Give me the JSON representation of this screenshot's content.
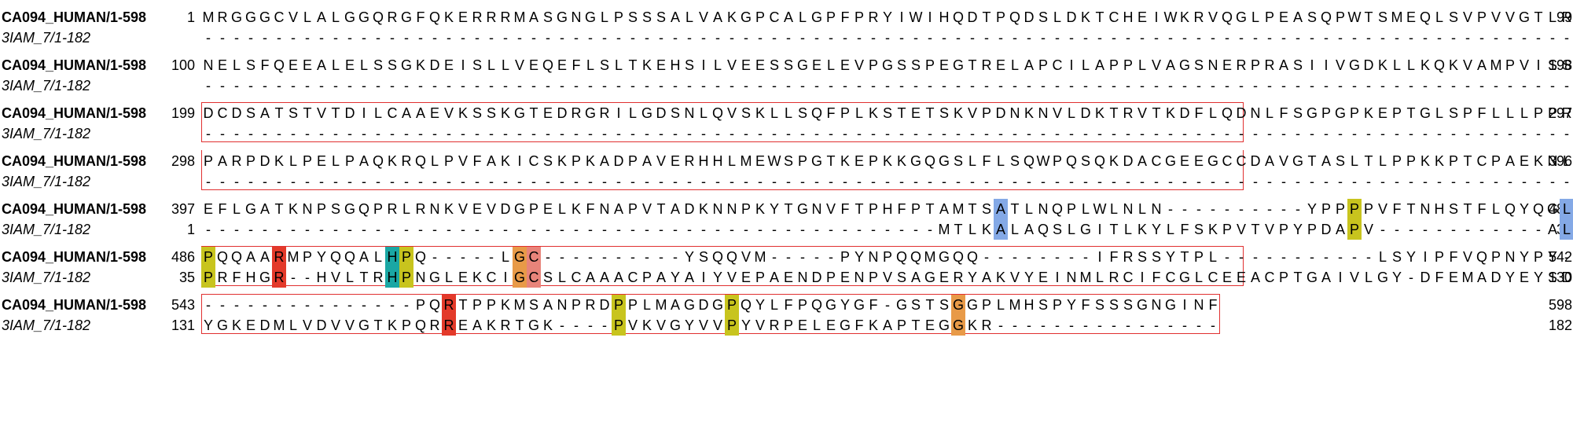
{
  "alignment": {
    "seq1_name": "CA094_HUMAN/1-598",
    "seq2_name": "3IAM_7/1-182",
    "blocks": [
      {
        "l1": "1",
        "s1": "MRGGGCVLALGGQRGFQKERRRMASGNGLPSSSALVAKGPCALGPFPRYIWIHQDTPQDSLDKTCHEIWKRVQGLPEASQPWTSMEQLSVPVVGTLRG",
        "r1": "99",
        "l2": "",
        "s2": "-------------------------------------------------------------------------------------------------",
        "r2": "",
        "box": "none"
      },
      {
        "l1": "100",
        "s1": "NELSFQEEALELSSGKDEISLLVEQEFLSLTKEHSILVEESSGELEVPGSSPEGTRELAPCILAPPLVAGSNERPRASIIVGDKLLKQKVAMPVISSRQ",
        "r1": "198",
        "l2": "",
        "s2": "---------------------------------------------------------------------------------------------------",
        "r2": "",
        "box": "none"
      },
      {
        "l1": "199",
        "s1": "DCDSATSTVTDILCAAEVKSSKGTEDRGRILGDSNLQVSKLLSQFPLKSTETSKVPDNKNVLDKTRVTKDFLQDNLFSGPGPKEPTGLSPFLLLPPRPP",
        "r1": "297",
        "l2": "",
        "s2": "---------------------------------------------------------------------------------------------------",
        "r2": "",
        "box": "full"
      },
      {
        "l1": "298",
        "s1": "PARPDKLPELPAQKRQLPVFAKICSKPKADPAVERHHLMEWSPGTKEPKKGQGSLFLSQWPQSQKDACGEEGCCDAVGTASLTLPPKKPTCPAEKNLLY",
        "r1": "396",
        "l2": "",
        "s2": "---------------------------------------------------------------------------------------------------",
        "r2": "",
        "box": "open-top"
      },
      {
        "l1": "397",
        "s1": "EFLGATKNPSGQPRLRNKVEVDGPELKFNAPVTADKNNPKYTGNVFTPHFPTAMTSATLNQPLWLNLN----------YPPPPVFTNHSTFLQYQGLY",
        "r1": "485",
        "l2": "1",
        "s2": "----------------------------------------------------MTLKALAQSLGITLKYLFSKPVTVPYPDAPV------------ALK",
        "r2": "34",
        "box": "none"
      },
      {
        "l1": "486",
        "s1": "PQQAARMPYQQALHPQ-----LGC----------YSQQVM-----PYNPQQMGQQ--------IFRSSYTPL-----------LSYIPFVQPNYPY----",
        "r1": "542",
        "l2": "35",
        "s2": "PRFHGR--HVLTRHPNGLEKCIGCSLCAAACPAYAIYVEPAENDPENPVSAGERYAKVYEINMLRCIFCGLCEEACPTGAIVLGY-DFEMADYEYSDLV",
        "r2": "130",
        "box": "full"
      },
      {
        "l1": "543",
        "s1": "---------------PQRTPPKMSANPRDPPLMAGDGPQYLFPQGYGF-GSTSGGPLMHSPYFSSSGNGINF",
        "r1": "598",
        "l2": "131",
        "s2": "YGKEDMLVDVVGTKPQRREAKRTGK----PVKVGYVVPYVRPELEGFKAPTEGGKR----------------",
        "r2": "182",
        "box": "full"
      }
    ]
  },
  "colors": {
    "Y": "#1aa7a4",
    "P": "#c8c41e",
    "A": "#84a9e6",
    "L": "#84a9e6",
    "I": "#84a9e6",
    "V": "#84a9e6",
    "M": "#84a9e6",
    "F": "#84a9e6",
    "W": "#84a9e6",
    "C": "#e8847a",
    "G": "#e89a48",
    "Q": "#2fc42f",
    "N": "#2fc42f",
    "S": "#2fc42f",
    "T": "#2fc42f",
    "R": "#e33a2a",
    "K": "#e33a2a",
    "E": "#c05ac8",
    "D": "#c05ac8",
    "H": "#1aa7a4",
    "box": "#e03030"
  }
}
